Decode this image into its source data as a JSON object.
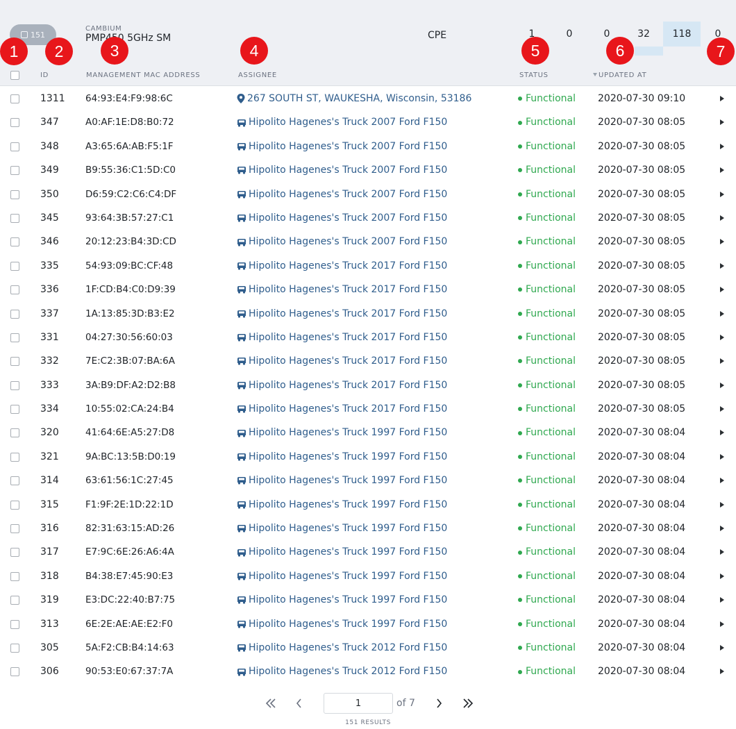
{
  "device": {
    "count": "151",
    "vendor": "CAMBIUM",
    "model": "PMP450 5GHz SM",
    "type": "CPE",
    "stats": [
      "1",
      "0",
      "0",
      "32",
      "118",
      "0"
    ]
  },
  "columns": {
    "id": "ID",
    "mac": "MANAGEMENT MAC ADDRESS",
    "assignee": "ASSIGNEE",
    "status": "STATUS",
    "updated": "UPDATED AT"
  },
  "badges": [
    "1",
    "2",
    "3",
    "4",
    "5",
    "6",
    "7"
  ],
  "rows": [
    {
      "id": "1311",
      "mac": "64:93:E4:F9:98:6C",
      "assignee": "267 SOUTH ST, WAUKESHA, Wisconsin, 53186",
      "assignee_icon": "location-pin-icon",
      "status": "Functional",
      "updated": "2020-07-30 09:10"
    },
    {
      "id": "347",
      "mac": "A0:AF:1E:D8:B0:72",
      "assignee": "Hipolito Hagenes's Truck 2007 Ford F150",
      "assignee_icon": "truck-icon",
      "status": "Functional",
      "updated": "2020-07-30 08:05"
    },
    {
      "id": "348",
      "mac": "A3:65:6A:AB:F5:1F",
      "assignee": "Hipolito Hagenes's Truck 2007 Ford F150",
      "assignee_icon": "truck-icon",
      "status": "Functional",
      "updated": "2020-07-30 08:05"
    },
    {
      "id": "349",
      "mac": "B9:55:36:C1:5D:C0",
      "assignee": "Hipolito Hagenes's Truck 2007 Ford F150",
      "assignee_icon": "truck-icon",
      "status": "Functional",
      "updated": "2020-07-30 08:05"
    },
    {
      "id": "350",
      "mac": "D6:59:C2:C6:C4:DF",
      "assignee": "Hipolito Hagenes's Truck 2007 Ford F150",
      "assignee_icon": "truck-icon",
      "status": "Functional",
      "updated": "2020-07-30 08:05"
    },
    {
      "id": "345",
      "mac": "93:64:3B:57:27:C1",
      "assignee": "Hipolito Hagenes's Truck 2007 Ford F150",
      "assignee_icon": "truck-icon",
      "status": "Functional",
      "updated": "2020-07-30 08:05"
    },
    {
      "id": "346",
      "mac": "20:12:23:B4:3D:CD",
      "assignee": "Hipolito Hagenes's Truck 2007 Ford F150",
      "assignee_icon": "truck-icon",
      "status": "Functional",
      "updated": "2020-07-30 08:05"
    },
    {
      "id": "335",
      "mac": "54:93:09:BC:CF:48",
      "assignee": "Hipolito Hagenes's Truck 2017 Ford F150",
      "assignee_icon": "truck-icon",
      "status": "Functional",
      "updated": "2020-07-30 08:05"
    },
    {
      "id": "336",
      "mac": "1F:CD:B4:C0:D9:39",
      "assignee": "Hipolito Hagenes's Truck 2017 Ford F150",
      "assignee_icon": "truck-icon",
      "status": "Functional",
      "updated": "2020-07-30 08:05"
    },
    {
      "id": "337",
      "mac": "1A:13:85:3D:B3:E2",
      "assignee": "Hipolito Hagenes's Truck 2017 Ford F150",
      "assignee_icon": "truck-icon",
      "status": "Functional",
      "updated": "2020-07-30 08:05"
    },
    {
      "id": "331",
      "mac": "04:27:30:56:60:03",
      "assignee": "Hipolito Hagenes's Truck 2017 Ford F150",
      "assignee_icon": "truck-icon",
      "status": "Functional",
      "updated": "2020-07-30 08:05"
    },
    {
      "id": "332",
      "mac": "7E:C2:3B:07:BA:6A",
      "assignee": "Hipolito Hagenes's Truck 2017 Ford F150",
      "assignee_icon": "truck-icon",
      "status": "Functional",
      "updated": "2020-07-30 08:05"
    },
    {
      "id": "333",
      "mac": "3A:B9:DF:A2:D2:B8",
      "assignee": "Hipolito Hagenes's Truck 2017 Ford F150",
      "assignee_icon": "truck-icon",
      "status": "Functional",
      "updated": "2020-07-30 08:05"
    },
    {
      "id": "334",
      "mac": "10:55:02:CA:24:B4",
      "assignee": "Hipolito Hagenes's Truck 2017 Ford F150",
      "assignee_icon": "truck-icon",
      "status": "Functional",
      "updated": "2020-07-30 08:05"
    },
    {
      "id": "320",
      "mac": "41:64:6E:A5:27:D8",
      "assignee": "Hipolito Hagenes's Truck 1997 Ford F150",
      "assignee_icon": "truck-icon",
      "status": "Functional",
      "updated": "2020-07-30 08:04"
    },
    {
      "id": "321",
      "mac": "9A:BC:13:5B:D0:19",
      "assignee": "Hipolito Hagenes's Truck 1997 Ford F150",
      "assignee_icon": "truck-icon",
      "status": "Functional",
      "updated": "2020-07-30 08:04"
    },
    {
      "id": "314",
      "mac": "63:61:56:1C:27:45",
      "assignee": "Hipolito Hagenes's Truck 1997 Ford F150",
      "assignee_icon": "truck-icon",
      "status": "Functional",
      "updated": "2020-07-30 08:04"
    },
    {
      "id": "315",
      "mac": "F1:9F:2E:1D:22:1D",
      "assignee": "Hipolito Hagenes's Truck 1997 Ford F150",
      "assignee_icon": "truck-icon",
      "status": "Functional",
      "updated": "2020-07-30 08:04"
    },
    {
      "id": "316",
      "mac": "82:31:63:15:AD:26",
      "assignee": "Hipolito Hagenes's Truck 1997 Ford F150",
      "assignee_icon": "truck-icon",
      "status": "Functional",
      "updated": "2020-07-30 08:04"
    },
    {
      "id": "317",
      "mac": "E7:9C:6E:26:A6:4A",
      "assignee": "Hipolito Hagenes's Truck 1997 Ford F150",
      "assignee_icon": "truck-icon",
      "status": "Functional",
      "updated": "2020-07-30 08:04"
    },
    {
      "id": "318",
      "mac": "B4:38:E7:45:90:E3",
      "assignee": "Hipolito Hagenes's Truck 1997 Ford F150",
      "assignee_icon": "truck-icon",
      "status": "Functional",
      "updated": "2020-07-30 08:04"
    },
    {
      "id": "319",
      "mac": "E3:DC:22:40:B7:75",
      "assignee": "Hipolito Hagenes's Truck 1997 Ford F150",
      "assignee_icon": "truck-icon",
      "status": "Functional",
      "updated": "2020-07-30 08:04"
    },
    {
      "id": "313",
      "mac": "6E:2E:AE:AE:E2:F0",
      "assignee": "Hipolito Hagenes's Truck 1997 Ford F150",
      "assignee_icon": "truck-icon",
      "status": "Functional",
      "updated": "2020-07-30 08:04"
    },
    {
      "id": "305",
      "mac": "5A:F2:CB:B4:14:63",
      "assignee": "Hipolito Hagenes's Truck 2012 Ford F150",
      "assignee_icon": "truck-icon",
      "status": "Functional",
      "updated": "2020-07-30 08:04"
    },
    {
      "id": "306",
      "mac": "90:53:E0:67:37:7A",
      "assignee": "Hipolito Hagenes's Truck 2012 Ford F150",
      "assignee_icon": "truck-icon",
      "status": "Functional",
      "updated": "2020-07-30 08:04"
    }
  ],
  "pagination": {
    "current_page": "1",
    "of_label": "of 7",
    "results": "151 RESULTS"
  },
  "colors": {
    "status_ok": "#2fa84f",
    "link": "#2f5d8c",
    "badge": "#e8161b",
    "highlight": "#d6e7f4"
  }
}
